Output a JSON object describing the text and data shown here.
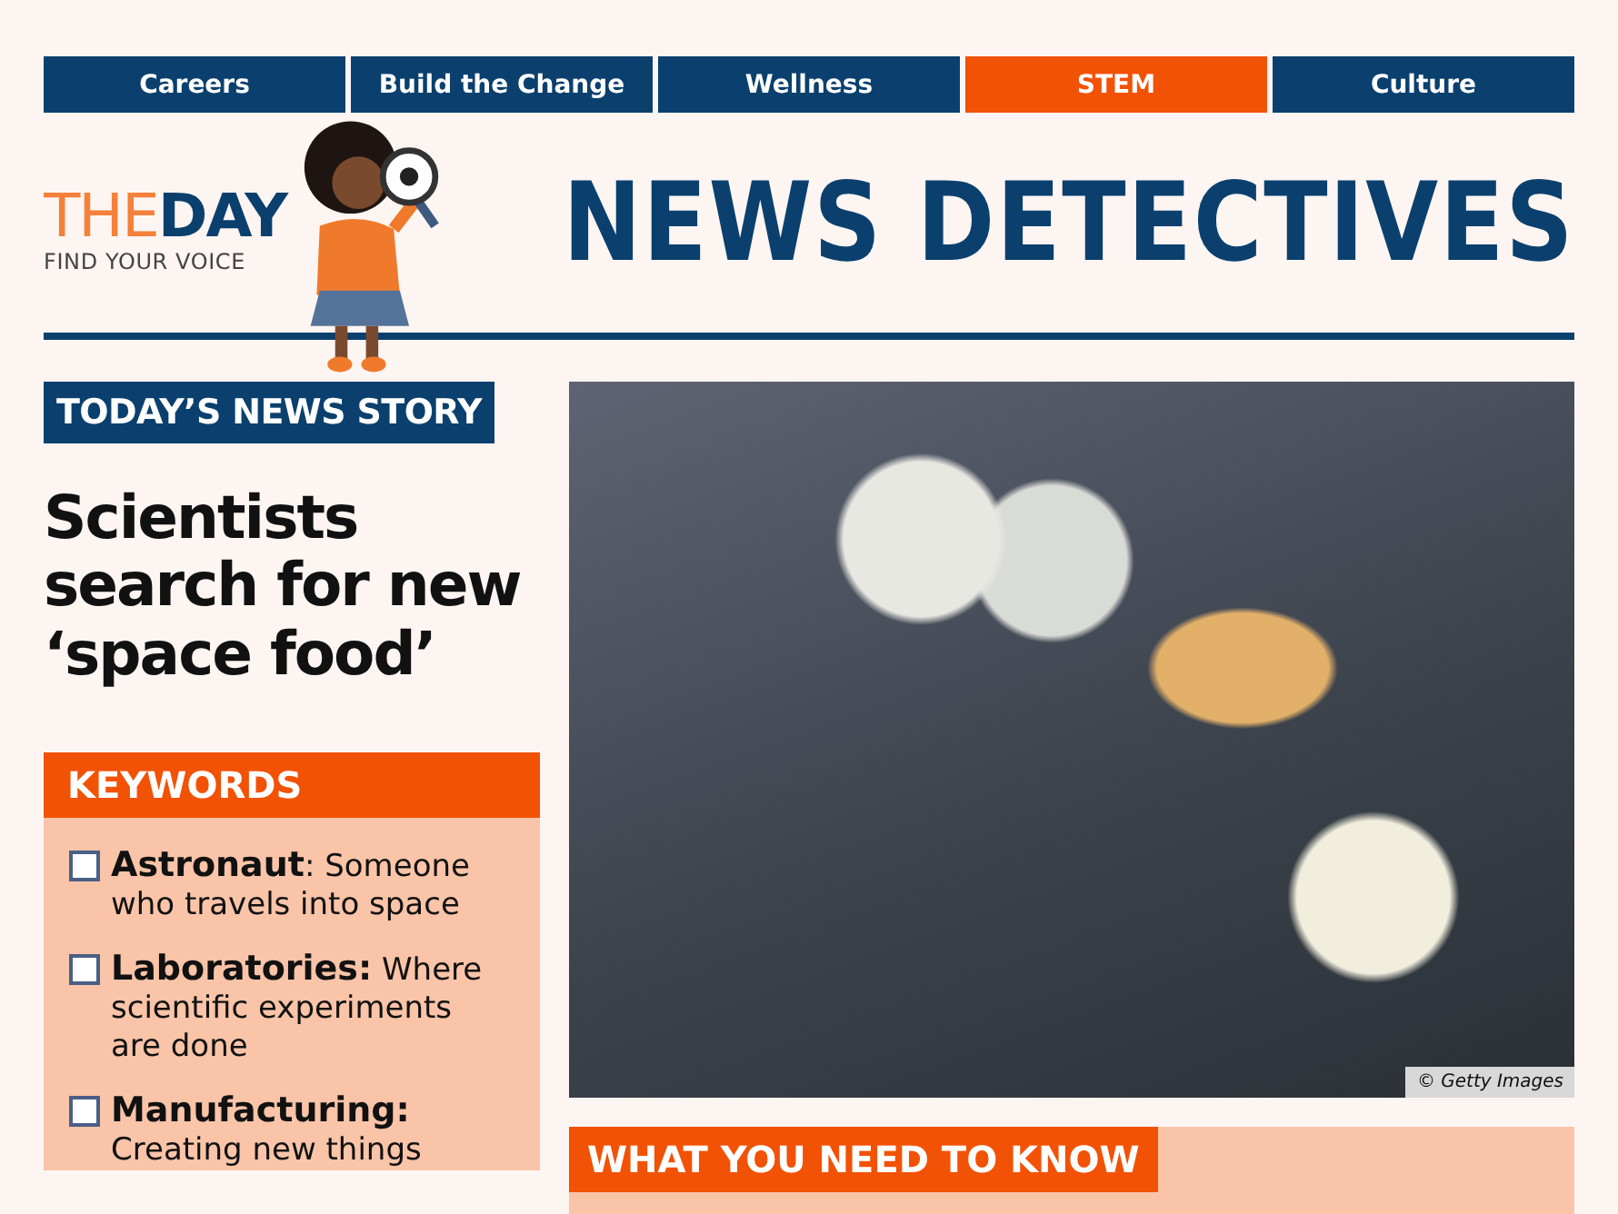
{
  "nav": [
    {
      "label": "Careers",
      "selected": false
    },
    {
      "label": "Build the Change",
      "selected": false
    },
    {
      "label": "Wellness",
      "selected": false
    },
    {
      "label": "STEM",
      "selected": true
    },
    {
      "label": "Culture",
      "selected": false
    }
  ],
  "logo": {
    "the": "THE",
    "day": "DAY",
    "tagline": "FIND YOUR VOICE"
  },
  "title": "NEWS DETECTIVES",
  "story": {
    "banner": "TODAY’S NEWS STORY",
    "headline": "Scientists search for new ‘space food’"
  },
  "keywords": {
    "heading": "KEYWORDS",
    "items": [
      {
        "text": "**Astronaut**: Someone who travels into space",
        "checked": false
      },
      {
        "text": "**Laboratories:** Where scientific experiments are done",
        "checked": false
      },
      {
        "text": "**Manufacturing:** Creating new things",
        "checked": false
      }
    ]
  },
  "photo": {
    "credit": "© Getty Images"
  },
  "need_to_know": {
    "heading": "WHAT YOU NEED TO KNOW"
  }
}
